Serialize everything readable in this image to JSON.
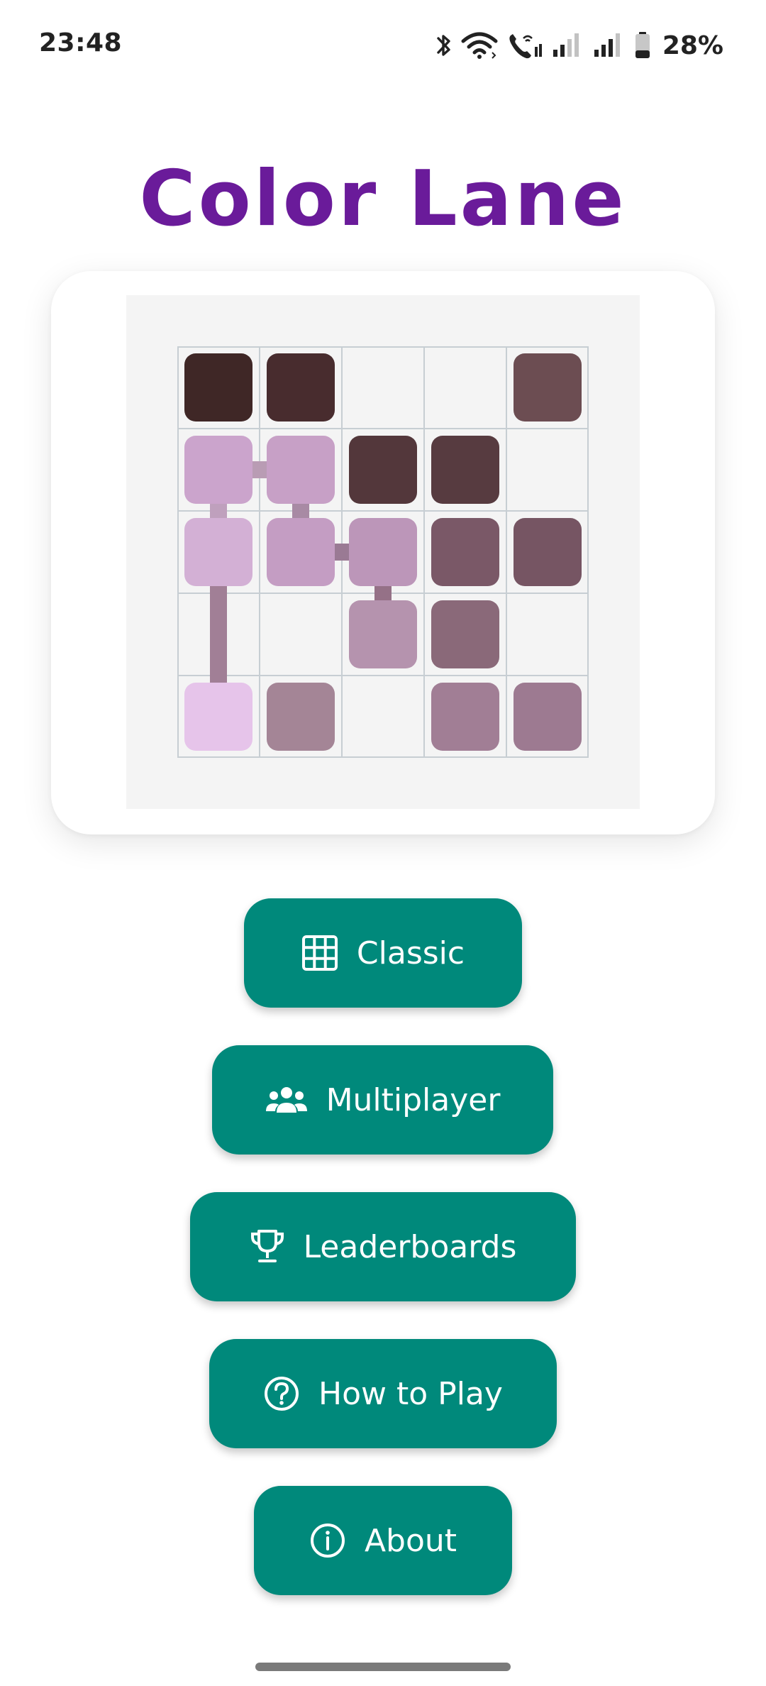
{
  "status_bar": {
    "time": "23:48",
    "battery_percent": "28%",
    "battery_level": 0.28,
    "icons": [
      "bluetooth-icon",
      "wifi-icon",
      "wifi-calling-icon",
      "signal-icon",
      "signal-icon",
      "battery-icon"
    ]
  },
  "app": {
    "title": "Color Lane",
    "title_color": "#6a1b9a",
    "accent_color": "#00897b"
  },
  "board": {
    "rows": 5,
    "cols": 5,
    "cells": [
      [
        "#3f2726",
        "#482c2e",
        null,
        null,
        "#6c4d52"
      ],
      [
        "#cba4cc",
        "#c7a0c6",
        "#53373b",
        "#573b40",
        null
      ],
      [
        "#d3b0d5",
        "#c49dc3",
        "#bc96b9",
        "#7a5867",
        "#765563"
      ],
      [
        null,
        null,
        "#b593ae",
        "#8a6979",
        null
      ],
      [
        "#e6c4ea",
        "#a48596",
        null,
        "#a17e95",
        "#9d7a91"
      ]
    ],
    "links": [
      {
        "r1": 1,
        "c1": 0,
        "r2": 1,
        "c2": 1,
        "color": "#b99cb4"
      },
      {
        "r1": 1,
        "c1": 0,
        "r2": 2,
        "c2": 0,
        "color": "#bfa0bd"
      },
      {
        "r1": 1,
        "c1": 1,
        "r2": 2,
        "c2": 1,
        "color": "#a88aa4"
      },
      {
        "r1": 2,
        "c1": 1,
        "r2": 2,
        "c2": 2,
        "color": "#9a7a94"
      },
      {
        "r1": 2,
        "c1": 2,
        "r2": 3,
        "c2": 2,
        "color": "#957187"
      },
      {
        "r1": 2,
        "c1": 0,
        "r2": 4,
        "c2": 0,
        "color": "#a17f96"
      }
    ]
  },
  "menu": {
    "classic": {
      "label": "Classic",
      "icon": "grid-icon"
    },
    "multiplayer": {
      "label": "Multiplayer",
      "icon": "group-icon"
    },
    "leaderboards": {
      "label": "Leaderboards",
      "icon": "trophy-icon"
    },
    "how_to_play": {
      "label": "How to Play",
      "icon": "help-circle-icon"
    },
    "about": {
      "label": "About",
      "icon": "info-icon"
    }
  }
}
